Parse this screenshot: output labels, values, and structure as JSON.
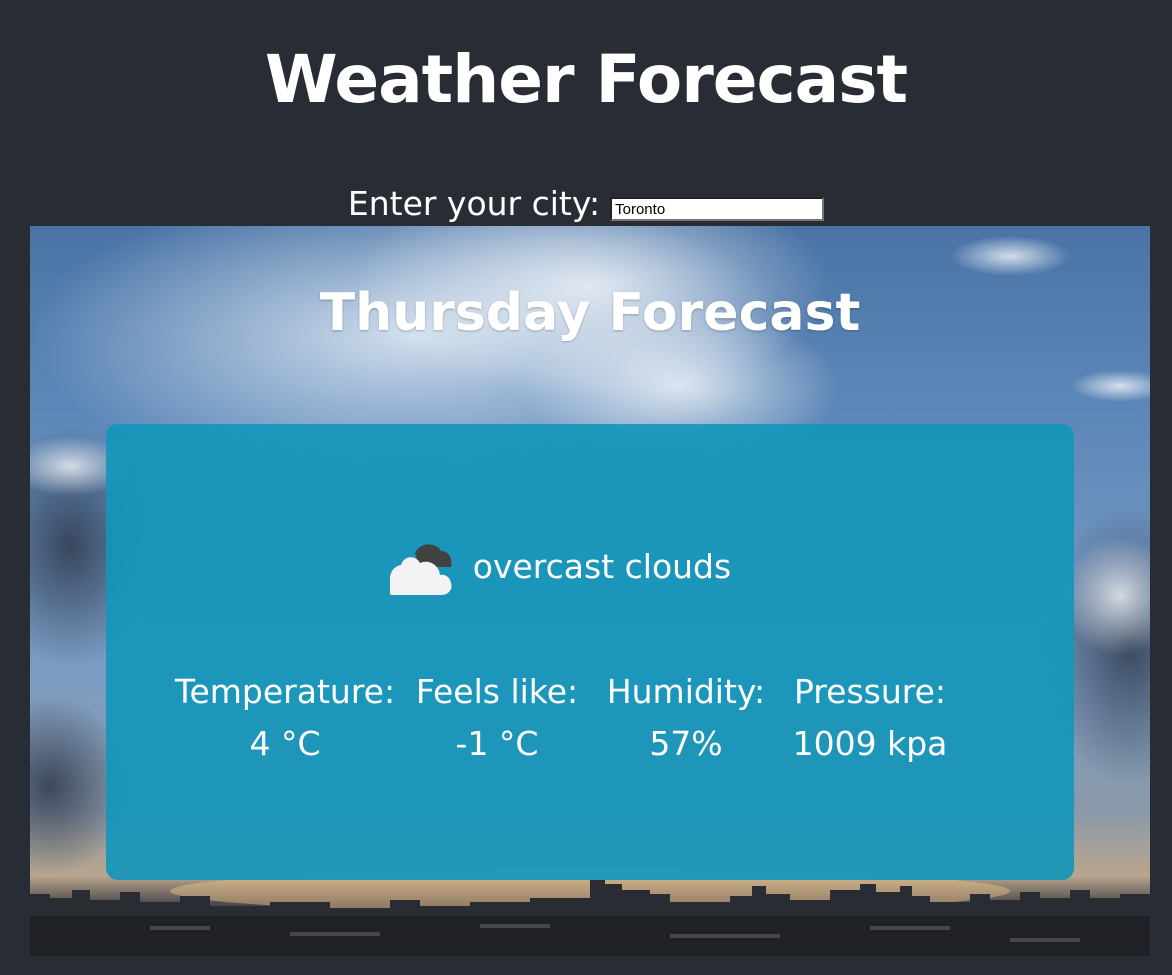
{
  "app": {
    "title": "Weather Forecast"
  },
  "search": {
    "label": "Enter your city:",
    "value": "Toronto"
  },
  "forecast": {
    "day_title": "Thursday Forecast",
    "condition": {
      "icon": "cloud-icon",
      "text": "overcast clouds"
    },
    "stats": [
      {
        "label": "Temperature:",
        "value": "4 °C"
      },
      {
        "label": "Feels like:",
        "value": "-1 °C"
      },
      {
        "label": "Humidity:",
        "value": "57%"
      },
      {
        "label": "Pressure:",
        "value": "1009 kpa"
      }
    ]
  },
  "colors": {
    "page_background": "#282c34",
    "card_background": "#1a96b9",
    "text": "#ffffff"
  }
}
